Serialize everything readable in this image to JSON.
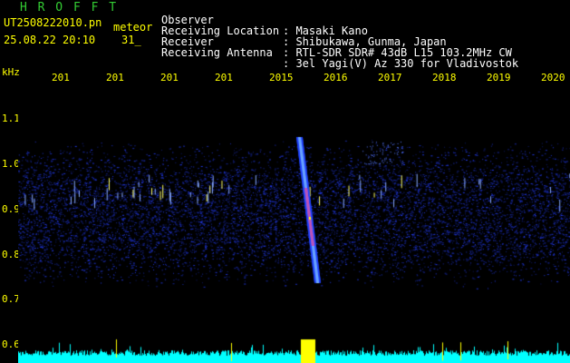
{
  "header": {
    "app_title": "H R O F F T",
    "file_name": "UT2508222010.pn",
    "file_tag": "meteor",
    "date_time": "25.08.22 20:10    31_"
  },
  "info": [
    {
      "label": "Observer",
      "value": ": Masaki Kano"
    },
    {
      "label": "Receiving Location",
      "value": ": Shibukawa, Gunma, Japan"
    },
    {
      "label": "Receiver",
      "value": ": RTL-SDR SDR# 43dB L15 103.2MHz CW"
    },
    {
      "label": "Receiving Antenna",
      "value": ": 3el Yagi(V) Az 330 for Vladivostok"
    }
  ],
  "chart_data": {
    "type": "heatmap",
    "ylabel": "kHz",
    "y_ticks": [
      "1.1",
      "1.0",
      "0.9",
      "0.8",
      "0.7",
      "0.6"
    ],
    "x_ticks": [
      "201",
      "201",
      "201",
      "201",
      "2015",
      "2016",
      "2017",
      "2018",
      "2019",
      "2020"
    ],
    "ylim": [
      0.6,
      1.13
    ],
    "noise_band_khz": [
      0.78,
      1.0
    ],
    "meteor_trace": {
      "top_khz": 1.06,
      "bottom_khz": 0.74,
      "top_time_label": "2015",
      "bottom_time_label": "2016"
    },
    "colors": {
      "background": "#000000",
      "labels": "#ffff00",
      "title": "#33cc33",
      "noise": "#2233cc",
      "trace": "#ff2288",
      "signal_level": "#00ffff"
    }
  }
}
